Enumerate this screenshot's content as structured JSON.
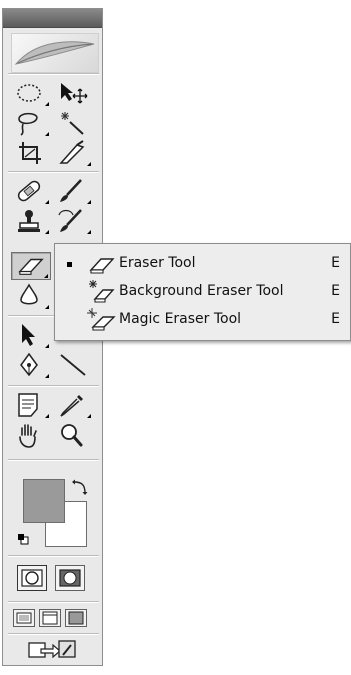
{
  "toolbox": {
    "tools": [
      {
        "id": "marquee",
        "name": "elliptical-marquee-tool"
      },
      {
        "id": "move",
        "name": "move-tool"
      },
      {
        "id": "lasso",
        "name": "lasso-tool"
      },
      {
        "id": "wand",
        "name": "magic-wand-tool"
      },
      {
        "id": "crop",
        "name": "crop-tool"
      },
      {
        "id": "slice",
        "name": "slice-tool"
      },
      {
        "id": "heal",
        "name": "healing-brush-tool"
      },
      {
        "id": "brush",
        "name": "brush-tool"
      },
      {
        "id": "stamp",
        "name": "clone-stamp-tool"
      },
      {
        "id": "history",
        "name": "history-brush-tool"
      },
      {
        "id": "eraser",
        "name": "eraser-tool"
      },
      {
        "id": "blur",
        "name": "blur-tool"
      },
      {
        "id": "select",
        "name": "path-selection-tool"
      },
      {
        "id": "pen",
        "name": "pen-tool"
      },
      {
        "id": "line",
        "name": "line-tool"
      },
      {
        "id": "notes",
        "name": "notes-tool"
      },
      {
        "id": "eyedropper",
        "name": "eyedropper-tool"
      },
      {
        "id": "hand",
        "name": "hand-tool"
      },
      {
        "id": "zoom",
        "name": "zoom-tool"
      }
    ],
    "colors": {
      "foreground": "#9a9a9a",
      "background": "#ffffff"
    }
  },
  "flyout": {
    "items": [
      {
        "label": "Eraser Tool",
        "shortcut": "E",
        "selected": true
      },
      {
        "label": "Background Eraser Tool",
        "shortcut": "E",
        "selected": false
      },
      {
        "label": "Magic Eraser Tool",
        "shortcut": "E",
        "selected": false
      }
    ]
  }
}
